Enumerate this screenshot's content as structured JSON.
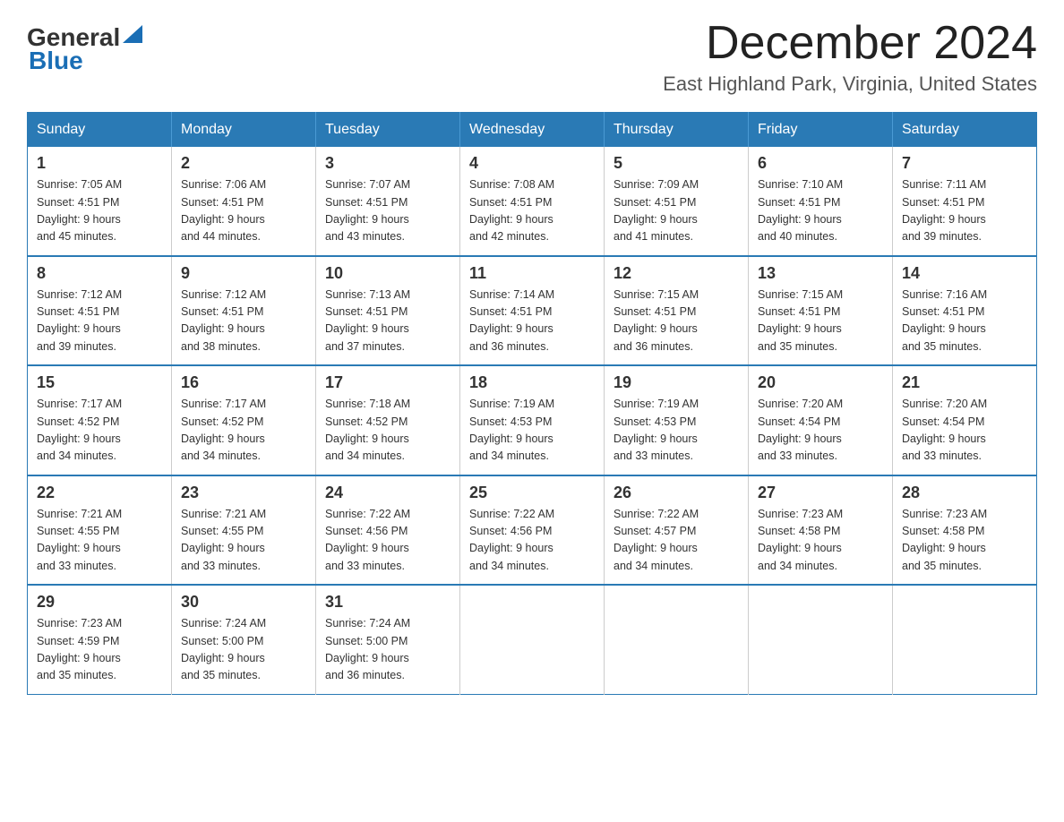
{
  "header": {
    "logo_general": "General",
    "logo_blue": "Blue",
    "month_title": "December 2024",
    "location": "East Highland Park, Virginia, United States"
  },
  "weekdays": [
    "Sunday",
    "Monday",
    "Tuesday",
    "Wednesday",
    "Thursday",
    "Friday",
    "Saturday"
  ],
  "weeks": [
    [
      {
        "day": "1",
        "sunrise": "7:05 AM",
        "sunset": "4:51 PM",
        "daylight": "9 hours and 45 minutes."
      },
      {
        "day": "2",
        "sunrise": "7:06 AM",
        "sunset": "4:51 PM",
        "daylight": "9 hours and 44 minutes."
      },
      {
        "day": "3",
        "sunrise": "7:07 AM",
        "sunset": "4:51 PM",
        "daylight": "9 hours and 43 minutes."
      },
      {
        "day": "4",
        "sunrise": "7:08 AM",
        "sunset": "4:51 PM",
        "daylight": "9 hours and 42 minutes."
      },
      {
        "day": "5",
        "sunrise": "7:09 AM",
        "sunset": "4:51 PM",
        "daylight": "9 hours and 41 minutes."
      },
      {
        "day": "6",
        "sunrise": "7:10 AM",
        "sunset": "4:51 PM",
        "daylight": "9 hours and 40 minutes."
      },
      {
        "day": "7",
        "sunrise": "7:11 AM",
        "sunset": "4:51 PM",
        "daylight": "9 hours and 39 minutes."
      }
    ],
    [
      {
        "day": "8",
        "sunrise": "7:12 AM",
        "sunset": "4:51 PM",
        "daylight": "9 hours and 39 minutes."
      },
      {
        "day": "9",
        "sunrise": "7:12 AM",
        "sunset": "4:51 PM",
        "daylight": "9 hours and 38 minutes."
      },
      {
        "day": "10",
        "sunrise": "7:13 AM",
        "sunset": "4:51 PM",
        "daylight": "9 hours and 37 minutes."
      },
      {
        "day": "11",
        "sunrise": "7:14 AM",
        "sunset": "4:51 PM",
        "daylight": "9 hours and 36 minutes."
      },
      {
        "day": "12",
        "sunrise": "7:15 AM",
        "sunset": "4:51 PM",
        "daylight": "9 hours and 36 minutes."
      },
      {
        "day": "13",
        "sunrise": "7:15 AM",
        "sunset": "4:51 PM",
        "daylight": "9 hours and 35 minutes."
      },
      {
        "day": "14",
        "sunrise": "7:16 AM",
        "sunset": "4:51 PM",
        "daylight": "9 hours and 35 minutes."
      }
    ],
    [
      {
        "day": "15",
        "sunrise": "7:17 AM",
        "sunset": "4:52 PM",
        "daylight": "9 hours and 34 minutes."
      },
      {
        "day": "16",
        "sunrise": "7:17 AM",
        "sunset": "4:52 PM",
        "daylight": "9 hours and 34 minutes."
      },
      {
        "day": "17",
        "sunrise": "7:18 AM",
        "sunset": "4:52 PM",
        "daylight": "9 hours and 34 minutes."
      },
      {
        "day": "18",
        "sunrise": "7:19 AM",
        "sunset": "4:53 PM",
        "daylight": "9 hours and 34 minutes."
      },
      {
        "day": "19",
        "sunrise": "7:19 AM",
        "sunset": "4:53 PM",
        "daylight": "9 hours and 33 minutes."
      },
      {
        "day": "20",
        "sunrise": "7:20 AM",
        "sunset": "4:54 PM",
        "daylight": "9 hours and 33 minutes."
      },
      {
        "day": "21",
        "sunrise": "7:20 AM",
        "sunset": "4:54 PM",
        "daylight": "9 hours and 33 minutes."
      }
    ],
    [
      {
        "day": "22",
        "sunrise": "7:21 AM",
        "sunset": "4:55 PM",
        "daylight": "9 hours and 33 minutes."
      },
      {
        "day": "23",
        "sunrise": "7:21 AM",
        "sunset": "4:55 PM",
        "daylight": "9 hours and 33 minutes."
      },
      {
        "day": "24",
        "sunrise": "7:22 AM",
        "sunset": "4:56 PM",
        "daylight": "9 hours and 33 minutes."
      },
      {
        "day": "25",
        "sunrise": "7:22 AM",
        "sunset": "4:56 PM",
        "daylight": "9 hours and 34 minutes."
      },
      {
        "day": "26",
        "sunrise": "7:22 AM",
        "sunset": "4:57 PM",
        "daylight": "9 hours and 34 minutes."
      },
      {
        "day": "27",
        "sunrise": "7:23 AM",
        "sunset": "4:58 PM",
        "daylight": "9 hours and 34 minutes."
      },
      {
        "day": "28",
        "sunrise": "7:23 AM",
        "sunset": "4:58 PM",
        "daylight": "9 hours and 35 minutes."
      }
    ],
    [
      {
        "day": "29",
        "sunrise": "7:23 AM",
        "sunset": "4:59 PM",
        "daylight": "9 hours and 35 minutes."
      },
      {
        "day": "30",
        "sunrise": "7:24 AM",
        "sunset": "5:00 PM",
        "daylight": "9 hours and 35 minutes."
      },
      {
        "day": "31",
        "sunrise": "7:24 AM",
        "sunset": "5:00 PM",
        "daylight": "9 hours and 36 minutes."
      },
      null,
      null,
      null,
      null
    ]
  ],
  "labels": {
    "sunrise": "Sunrise:",
    "sunset": "Sunset:",
    "daylight": "Daylight:"
  }
}
